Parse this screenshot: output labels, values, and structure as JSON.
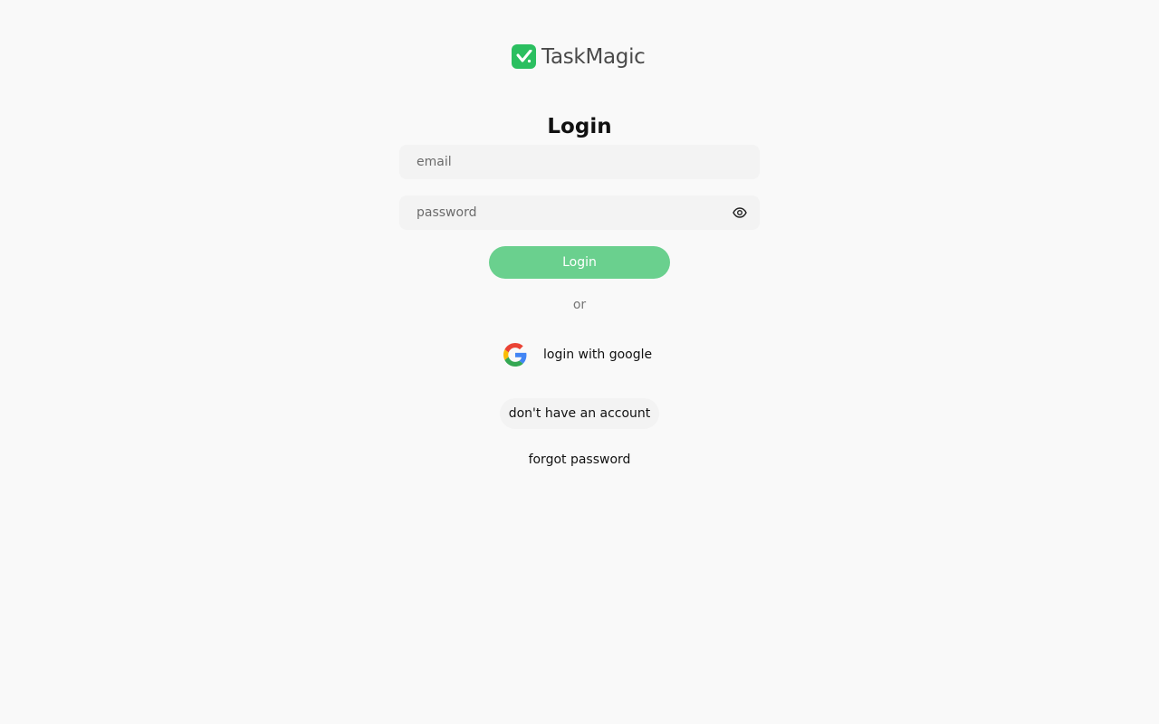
{
  "brand": {
    "name": "TaskMagic",
    "color": "#2bbf60",
    "icon": "check-icon"
  },
  "title": "Login",
  "form": {
    "email_placeholder": "email",
    "email_value": "",
    "password_placeholder": "password",
    "password_value": "",
    "password_toggle_icon": "eye-icon",
    "submit_label": "Login",
    "submit_color": "#6ad08e"
  },
  "divider": "or",
  "google": {
    "label": "login with google",
    "icon": "google-icon"
  },
  "links": {
    "signup": "don't have an account",
    "forgot": "forgot password"
  }
}
